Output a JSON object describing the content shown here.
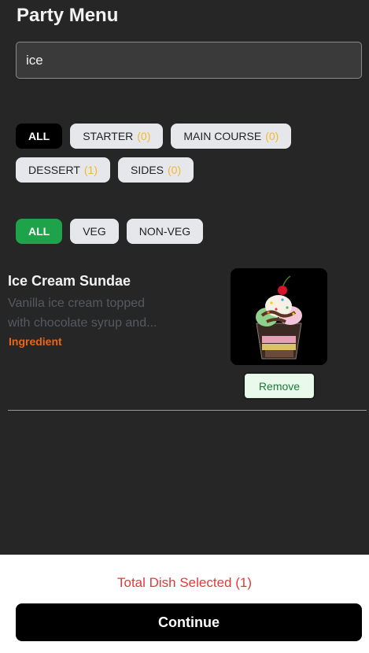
{
  "header": {
    "title": "Party Menu"
  },
  "search": {
    "value": "ice"
  },
  "course_filters": [
    {
      "label": "ALL",
      "count": "",
      "active": true
    },
    {
      "label": "STARTER",
      "count": "(0)",
      "active": false
    },
    {
      "label": "MAIN COURSE",
      "count": "(0)",
      "active": false
    },
    {
      "label": "DESSERT",
      "count": "(1)",
      "active": false
    },
    {
      "label": "SIDES",
      "count": "(0)",
      "active": false
    }
  ],
  "diet_filters": [
    {
      "label": "ALL",
      "active": true
    },
    {
      "label": "VEG",
      "active": false
    },
    {
      "label": "NON-VEG",
      "active": false
    }
  ],
  "dish": {
    "name": "Ice Cream Sundae",
    "description_line1": "Vanilla ice cream topped",
    "description_line2": "with chocolate syrup and...",
    "tag": "Ingredient",
    "action": "Remove",
    "image_icon": "sundae-image"
  },
  "footer": {
    "total_text": "Total Dish Selected (1)",
    "continue_label": "Continue"
  },
  "colors": {
    "background": "#262626",
    "accent_green": "#1ea34a",
    "count_yellow": "#f0b92f",
    "total_red": "#e03a3a",
    "tag_orange": "#e8661a"
  }
}
